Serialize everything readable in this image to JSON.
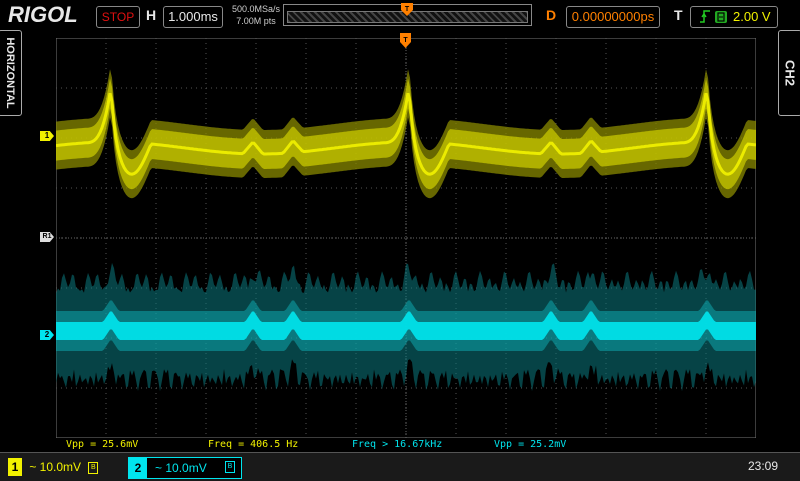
{
  "header": {
    "logo": "RIGOL",
    "run_state": "STOP",
    "h_label": "H",
    "timebase": "1.000ms",
    "sample_rate": "500.0MSa/s",
    "memory_depth": "7.00M pts",
    "trigger_marker": "T",
    "d_label": "D",
    "delay": "0.00000000ps",
    "t_label": "T",
    "trigger_edge_icon": "rising-edge-icon",
    "trigger_level": "2.00 V"
  },
  "side": {
    "left_tab": "HORIZONTAL",
    "right_tab": "CH2"
  },
  "markers": {
    "ch1_marker": "1",
    "ch2_marker": "2",
    "ref_marker": "R1",
    "trigger_top": "T"
  },
  "measurements": {
    "vpp1": "Vpp = 25.6mV",
    "freq1": "Freq = 406.5 Hz",
    "freq2": "Freq > 16.67kHz",
    "vpp2": "Vpp = 25.2mV"
  },
  "footer": {
    "ch1_num": "1",
    "ch1_scale": "~ 10.0mV",
    "ch2_num": "2",
    "ch2_scale": "~ 10.0mV",
    "clock": "23:09"
  },
  "colors": {
    "ch1": "#f2f200",
    "ch2": "#00e5ee",
    "trigger": "#ff8000",
    "stop": "#e01010"
  }
}
